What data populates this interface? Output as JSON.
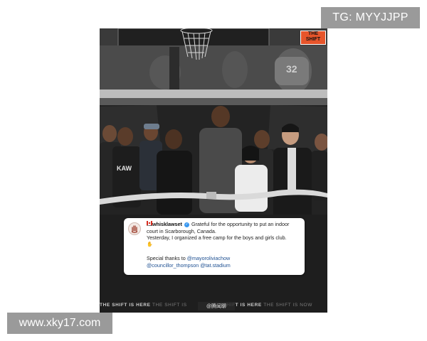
{
  "watermarks": {
    "top_right": "TG: MYYJJPP",
    "bottom_left": "www.xky17.com"
  },
  "badge": {
    "line1": "THE",
    "line2": "SHIFT"
  },
  "post": {
    "handle": "kawhisklawset",
    "text_line1": "Grateful for the opportunity to put an indoor",
    "text_line2": "court in Scarborough, Canada.",
    "text_line3": "Yesterday, I organized a free camp for the boys and girls club.",
    "thanks_prefix": "Special thanks to",
    "mention1": "@mayoroliviachow",
    "mention2": "@councillor_thompson",
    "mention3": "@tat.stadium"
  },
  "ticker": {
    "part1": "THE SHIFT IS HERE",
    "part2": "THE SHIFT IS",
    "weibo": "@腾闻聊",
    "part3": "SHIFT IS HERE",
    "part4": "THE SHIFT IS NOW"
  },
  "colors": {
    "badge": "#e7552b",
    "verified": "#3897f0",
    "mention": "#1d4f91"
  },
  "icons": {
    "verified": "verified-check-icon",
    "flag": "canada-flag-icon",
    "avatar": "hand-logo-icon"
  }
}
